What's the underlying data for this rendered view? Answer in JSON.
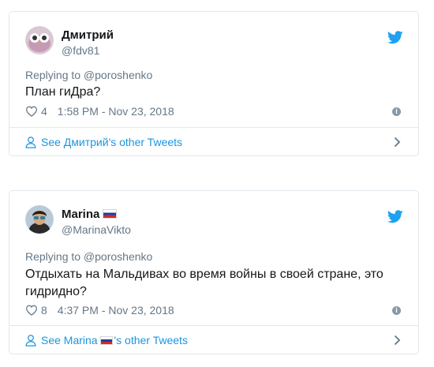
{
  "tweets": [
    {
      "name": "Дмитрий",
      "handle": "@fdv81",
      "replying": "Replying to @poroshenko",
      "text": "План гиДра?",
      "likes": "4",
      "timestamp": "1:58 PM - Nov 23, 2018",
      "see_more_label": "See Дмитрий's other Tweets"
    },
    {
      "name": "Marina",
      "handle": "@MarinaVikto",
      "replying": "Replying to @poroshenko",
      "text": "Отдыхать на Мальдивах во время войны в своей стране, это гидридно?",
      "likes": "8",
      "timestamp": "4:37 PM - Nov 23, 2018",
      "see_more_prefix": "See Marina ",
      "see_more_suffix": "'s other Tweets"
    }
  ],
  "icons": {
    "brand": "twitter-bird-icon",
    "like": "heart-icon",
    "info": "info-icon",
    "profile": "person-icon",
    "chevron": "chevron-right-icon",
    "flag": "russia-flag-icon"
  },
  "colors": {
    "accent": "#1da1f2",
    "link": "#1b95e0",
    "secondary_text": "#657786",
    "border": "#e1e8ed"
  }
}
